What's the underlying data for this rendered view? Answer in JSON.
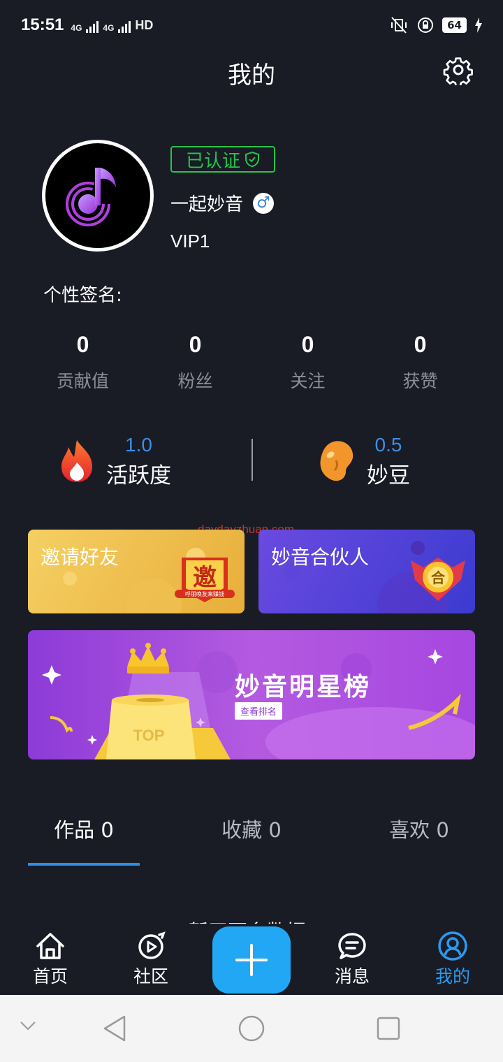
{
  "status_bar": {
    "time": "15:51",
    "network": "4G",
    "network2": "4G",
    "hd": "HD",
    "battery": "64"
  },
  "header": {
    "title": "我的",
    "settings_icon": "gear-icon"
  },
  "profile": {
    "verified_label": "已认证",
    "name": "一起妙音",
    "gender": "♂",
    "vip_level": "VIP1",
    "signature_label": "个性签名:"
  },
  "stats": [
    {
      "value": "0",
      "label": "贡献值"
    },
    {
      "value": "0",
      "label": "粉丝"
    },
    {
      "value": "0",
      "label": "关注"
    },
    {
      "value": "0",
      "label": "获赞"
    }
  ],
  "metrics": {
    "activity": {
      "value": "1.0",
      "label": "活跃度"
    },
    "beans": {
      "value": "0.5",
      "label": "妙豆"
    }
  },
  "watermark": "daydayzhuan.com",
  "cards": {
    "invite": {
      "title": "邀请好友",
      "badge": "邀",
      "badge_sub": "呼朋唤友来赚钱"
    },
    "partner": {
      "title": "妙音合伙人",
      "badge": "合"
    }
  },
  "banner": {
    "title": "妙音明星榜",
    "button": "查看排名",
    "top_label": "TOP"
  },
  "tabs": [
    {
      "label": "作品 0",
      "active": true
    },
    {
      "label": "收藏 0",
      "active": false
    },
    {
      "label": "喜欢 0",
      "active": false
    }
  ],
  "partial_text": "暂无更多数据",
  "bottom_nav": [
    {
      "label": "首页",
      "icon": "home-icon"
    },
    {
      "label": "社区",
      "icon": "community-icon"
    },
    {
      "label": "消息",
      "icon": "message-icon"
    },
    {
      "label": "我的",
      "icon": "profile-icon",
      "active": true
    }
  ],
  "colors": {
    "background": "#191b25",
    "accent": "#2a9af0",
    "verified": "#27c44b",
    "plus_button": "#22a7f5"
  }
}
